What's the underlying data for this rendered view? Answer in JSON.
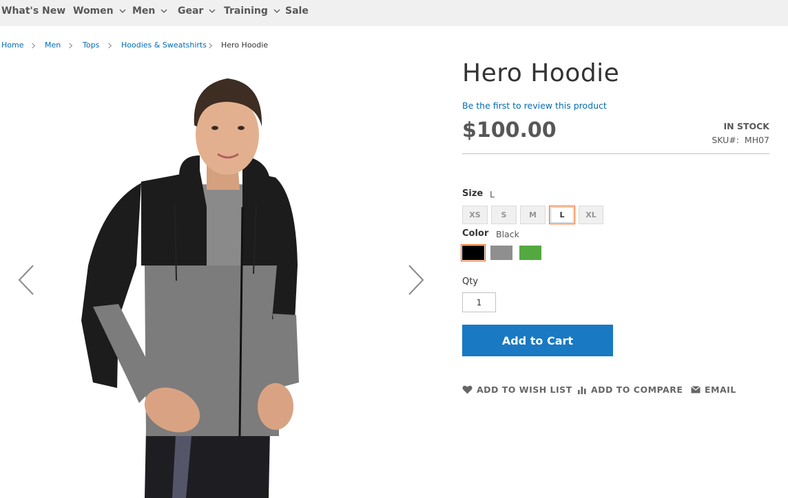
{
  "nav": {
    "items": [
      {
        "label": "What's New",
        "has_dropdown": false
      },
      {
        "label": "Women",
        "has_dropdown": true
      },
      {
        "label": "Men",
        "has_dropdown": true
      },
      {
        "label": "Gear",
        "has_dropdown": true
      },
      {
        "label": "Training",
        "has_dropdown": true
      },
      {
        "label": "Sale",
        "has_dropdown": false
      }
    ],
    "chevron_icon": "chevron-down-icon"
  },
  "breadcrumbs": [
    "Home",
    "Men",
    "Tops",
    "Hoodies & Sweatshirts",
    "Hero Hoodie"
  ],
  "gallery": {
    "prev_icon": "chevron-left-icon",
    "next_icon": "chevron-right-icon"
  },
  "product": {
    "name": "Hero Hoodie",
    "review_link": "Be the first to review this product",
    "price": "$100.00",
    "stock_status": "IN STOCK",
    "sku_label": "SKU#:",
    "sku": "MH07"
  },
  "options": {
    "size_label": "Size",
    "size_selected": "L",
    "sizes": [
      "XS",
      "S",
      "M",
      "L",
      "XL"
    ],
    "color_label": "Color",
    "color_selected": "Black",
    "colors": [
      {
        "name": "Black",
        "hex": "#000000"
      },
      {
        "name": "Gray",
        "hex": "#8f8f8f"
      },
      {
        "name": "Green",
        "hex": "#53a93f"
      }
    ]
  },
  "qty": {
    "label": "Qty",
    "value": "1"
  },
  "add_to_cart_label": "Add to Cart",
  "actions": {
    "wishlist": "ADD TO WISH LIST",
    "compare": "ADD TO COMPARE",
    "email": "EMAIL"
  },
  "colors": {
    "accent_blue": "#1979c3",
    "link_blue": "#006bb4",
    "selected_border": "#ff5501",
    "nav_bg": "#f0f0f0"
  }
}
